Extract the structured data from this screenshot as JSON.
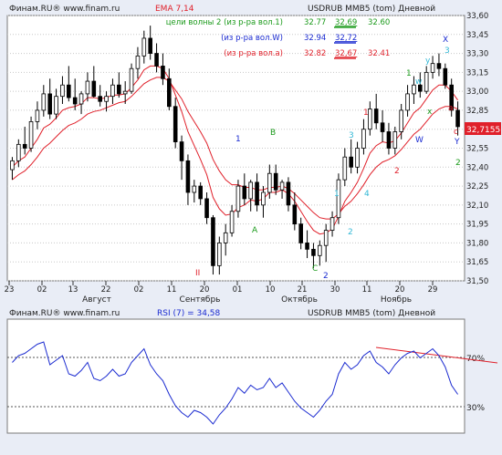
{
  "top_panel": {
    "source": "Финам.RU® www.finam.ru",
    "indicator": "EMA 7,14",
    "instrument": "USDRUB MMB5 (tom) Дневной",
    "indicator_color": "#e0202a"
  },
  "bottom_panel": {
    "source": "Финам.RU® www.finam.ru",
    "indicator": "RSI (7) = 34,58",
    "instrument": "USDRUB MMB5 (tom) Дневной",
    "indicator_color": "#1a2ad0"
  },
  "wave_table": [
    {
      "label": "цели волны 2 (из р-ра вол.1)",
      "v1": "32.77",
      "v2": "32,69",
      "v3": "32.60",
      "color": "#1a9a1a"
    },
    {
      "label": "(из р-ра вол.W)",
      "v1": "32.94",
      "v2": "32,72",
      "v3": "",
      "color": "#1a2ad0"
    },
    {
      "label": "(из р-ра вол.a)",
      "v1": "32.82",
      "v2": "32,67",
      "v3": "32.41",
      "color": "#e0202a"
    }
  ],
  "price_axis": [
    "33,60",
    "33,45",
    "33,30",
    "33,15",
    "33,00",
    "32,85",
    "32,70",
    "32,55",
    "32,40",
    "32,25",
    "32,10",
    "31,95",
    "31,80",
    "31,65",
    "31,50"
  ],
  "current_price": "32,7155",
  "date_ticks": [
    "23",
    "02",
    "13",
    "22",
    "02",
    "11",
    "20",
    "01",
    "10",
    "21",
    "30",
    "11",
    "20",
    "29"
  ],
  "month_labels": [
    "Август",
    "Сентябрь",
    "Октябрь",
    "Ноябрь"
  ],
  "rsi_levels": [
    "70%",
    "30%"
  ],
  "colors": {
    "up_candle": "#ffffff",
    "down_candle": "#000000",
    "ema_fast": "#e0202a",
    "ema_slow": "#e0202a",
    "rsi": "#1a2ad0",
    "grid": "#c8c8c8",
    "trend": "#e0202a"
  },
  "chart_data": {
    "type": "candlestick",
    "y_range": [
      31.5,
      33.6
    ],
    "rsi_range": [
      0,
      100
    ],
    "candles": [
      [
        32.38,
        32.48,
        32.3,
        32.45
      ],
      [
        32.45,
        32.62,
        32.4,
        32.58
      ],
      [
        32.58,
        32.72,
        32.5,
        32.55
      ],
      [
        32.55,
        32.8,
        32.52,
        32.76
      ],
      [
        32.76,
        32.92,
        32.7,
        32.85
      ],
      [
        32.85,
        33.05,
        32.8,
        32.98
      ],
      [
        32.98,
        33.1,
        32.78,
        32.82
      ],
      [
        32.82,
        33.02,
        32.78,
        32.96
      ],
      [
        32.96,
        33.12,
        32.9,
        33.05
      ],
      [
        33.05,
        33.2,
        32.92,
        32.95
      ],
      [
        32.95,
        33.1,
        32.85,
        32.9
      ],
      [
        32.9,
        33.0,
        32.82,
        32.98
      ],
      [
        32.98,
        33.15,
        32.92,
        33.08
      ],
      [
        33.08,
        33.2,
        32.95,
        32.96
      ],
      [
        32.96,
        33.05,
        32.88,
        32.92
      ],
      [
        32.92,
        33.0,
        32.84,
        32.96
      ],
      [
        32.96,
        33.1,
        32.9,
        33.05
      ],
      [
        33.05,
        33.15,
        32.95,
        32.98
      ],
      [
        32.98,
        33.08,
        32.9,
        33.0
      ],
      [
        33.0,
        33.22,
        32.98,
        33.18
      ],
      [
        33.18,
        33.35,
        33.1,
        33.28
      ],
      [
        33.28,
        33.48,
        33.22,
        33.42
      ],
      [
        33.42,
        33.52,
        33.25,
        33.3
      ],
      [
        33.3,
        33.38,
        33.15,
        33.2
      ],
      [
        33.2,
        33.3,
        33.05,
        33.1
      ],
      [
        33.1,
        33.18,
        32.85,
        32.88
      ],
      [
        32.88,
        32.95,
        32.55,
        32.6
      ],
      [
        32.6,
        32.65,
        32.3,
        32.45
      ],
      [
        32.45,
        32.5,
        32.1,
        32.2
      ],
      [
        32.2,
        32.3,
        32.12,
        32.25
      ],
      [
        32.25,
        32.28,
        32.1,
        32.15
      ],
      [
        32.15,
        32.2,
        31.95,
        32.0
      ],
      [
        32.0,
        32.02,
        31.55,
        31.62
      ],
      [
        31.62,
        31.85,
        31.55,
        31.8
      ],
      [
        31.8,
        31.95,
        31.7,
        31.88
      ],
      [
        31.88,
        32.1,
        31.85,
        32.05
      ],
      [
        32.05,
        32.3,
        32.0,
        32.25
      ],
      [
        32.25,
        32.35,
        32.1,
        32.15
      ],
      [
        32.15,
        32.3,
        32.05,
        32.28
      ],
      [
        32.28,
        32.35,
        32.05,
        32.1
      ],
      [
        32.1,
        32.25,
        32.0,
        32.2
      ],
      [
        32.2,
        32.42,
        32.15,
        32.35
      ],
      [
        32.35,
        32.42,
        32.18,
        32.22
      ],
      [
        32.22,
        32.3,
        32.15,
        32.28
      ],
      [
        32.28,
        32.32,
        32.05,
        32.1
      ],
      [
        32.1,
        32.2,
        31.9,
        31.95
      ],
      [
        31.95,
        32.0,
        31.75,
        31.8
      ],
      [
        31.8,
        31.9,
        31.68,
        31.75
      ],
      [
        31.75,
        31.8,
        31.6,
        31.7
      ],
      [
        31.7,
        31.82,
        31.62,
        31.78
      ],
      [
        31.78,
        31.95,
        31.65,
        31.9
      ],
      [
        31.9,
        32.05,
        31.85,
        32.0
      ],
      [
        32.0,
        32.35,
        31.95,
        32.3
      ],
      [
        32.3,
        32.55,
        32.25,
        32.48
      ],
      [
        32.48,
        32.62,
        32.35,
        32.4
      ],
      [
        32.4,
        32.6,
        32.35,
        32.55
      ],
      [
        32.55,
        32.78,
        32.5,
        32.7
      ],
      [
        32.7,
        32.92,
        32.65,
        32.86
      ],
      [
        32.86,
        32.98,
        32.7,
        32.75
      ],
      [
        32.75,
        32.85,
        32.6,
        32.68
      ],
      [
        32.68,
        32.75,
        32.5,
        32.55
      ],
      [
        32.55,
        32.72,
        32.5,
        32.68
      ],
      [
        32.68,
        32.9,
        32.62,
        32.85
      ],
      [
        32.85,
        33.05,
        32.8,
        32.98
      ],
      [
        32.98,
        33.12,
        32.9,
        33.05
      ],
      [
        33.05,
        33.15,
        32.95,
        33.0
      ],
      [
        33.0,
        33.2,
        32.98,
        33.15
      ],
      [
        33.15,
        33.28,
        33.1,
        33.22
      ],
      [
        33.22,
        33.3,
        33.12,
        33.18
      ],
      [
        33.18,
        33.22,
        33.02,
        33.05
      ],
      [
        33.05,
        33.1,
        32.8,
        32.85
      ],
      [
        32.85,
        32.92,
        32.65,
        32.72
      ]
    ],
    "ema_fast": [
      32.4,
      32.45,
      32.48,
      32.55,
      32.62,
      32.71,
      32.74,
      32.79,
      32.85,
      32.87,
      32.88,
      32.9,
      32.95,
      32.95,
      32.94,
      32.95,
      32.97,
      32.97,
      32.98,
      33.03,
      33.09,
      33.17,
      33.2,
      33.2,
      33.18,
      33.1,
      32.97,
      32.84,
      32.68,
      32.57,
      32.46,
      32.34,
      32.16,
      32.07,
      32.02,
      32.03,
      32.08,
      32.1,
      32.14,
      32.13,
      32.15,
      32.2,
      32.2,
      32.22,
      32.19,
      32.13,
      32.05,
      31.97,
      31.9,
      31.87,
      31.88,
      31.91,
      32.01,
      32.13,
      32.2,
      32.28,
      32.39,
      32.51,
      32.57,
      32.6,
      32.59,
      32.61,
      32.67,
      32.75,
      32.83,
      32.87,
      32.94,
      33.01,
      33.05,
      33.05,
      33.0,
      32.93
    ],
    "ema_slow": [
      32.3,
      32.34,
      32.37,
      32.42,
      32.48,
      32.55,
      32.59,
      32.64,
      32.69,
      32.73,
      32.75,
      32.78,
      32.82,
      32.84,
      32.85,
      32.87,
      32.89,
      32.91,
      32.92,
      32.96,
      33.01,
      33.06,
      33.09,
      33.11,
      33.11,
      33.08,
      33.01,
      32.94,
      32.84,
      32.76,
      32.68,
      32.59,
      32.46,
      32.37,
      32.3,
      32.26,
      32.26,
      32.24,
      32.24,
      32.22,
      32.22,
      32.24,
      32.24,
      32.25,
      32.23,
      32.19,
      32.14,
      32.09,
      32.04,
      32.0,
      31.99,
      31.99,
      32.03,
      32.09,
      32.13,
      32.19,
      32.26,
      32.34,
      32.4,
      32.44,
      32.46,
      32.49,
      32.54,
      32.6,
      32.66,
      32.7,
      32.76,
      32.82,
      32.86,
      32.88,
      32.88,
      32.86
    ],
    "rsi": [
      62,
      68,
      70,
      74,
      78,
      80,
      60,
      64,
      68,
      52,
      50,
      55,
      62,
      48,
      46,
      50,
      56,
      50,
      52,
      62,
      68,
      74,
      60,
      52,
      46,
      34,
      24,
      18,
      14,
      20,
      18,
      14,
      8,
      16,
      22,
      30,
      40,
      35,
      42,
      38,
      40,
      48,
      40,
      44,
      36,
      28,
      22,
      18,
      14,
      20,
      28,
      34,
      52,
      62,
      56,
      60,
      68,
      72,
      62,
      58,
      52,
      60,
      66,
      70,
      72,
      66,
      70,
      74,
      68,
      58,
      42,
      34
    ]
  }
}
